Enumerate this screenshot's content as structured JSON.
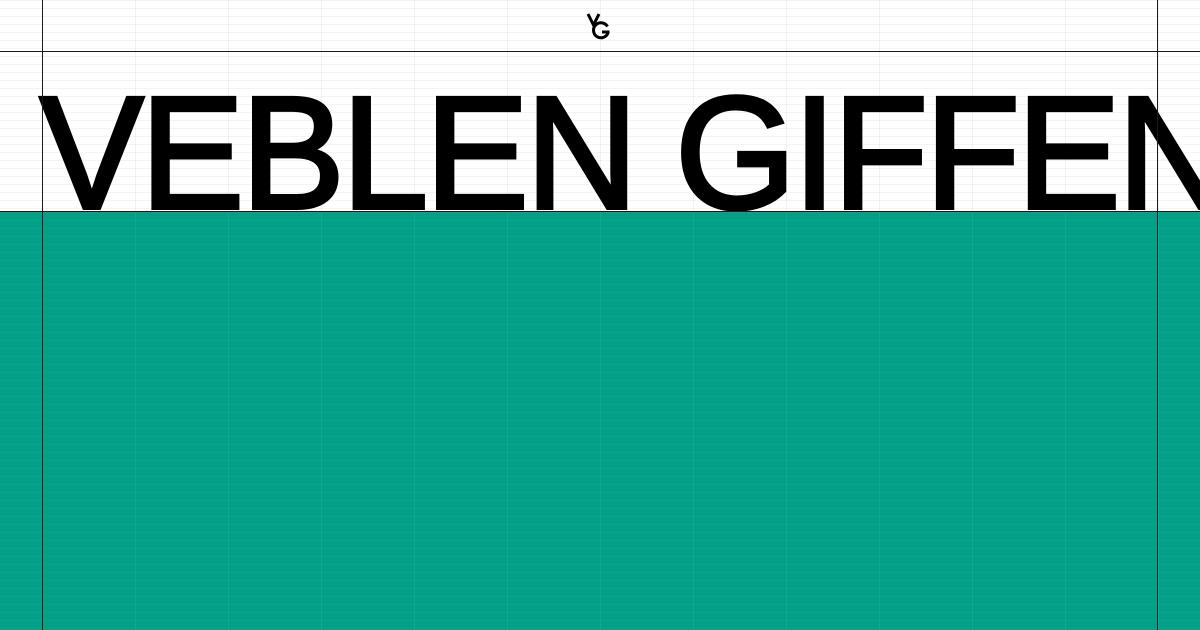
{
  "brand": {
    "logo_icon": "vg-monogram-icon",
    "wordmark": "VEBLEN GIFFEN"
  },
  "colors": {
    "background": "#ffffff",
    "accent_green": "#02a187",
    "text": "#000000",
    "rules": "#1a1a1a"
  }
}
